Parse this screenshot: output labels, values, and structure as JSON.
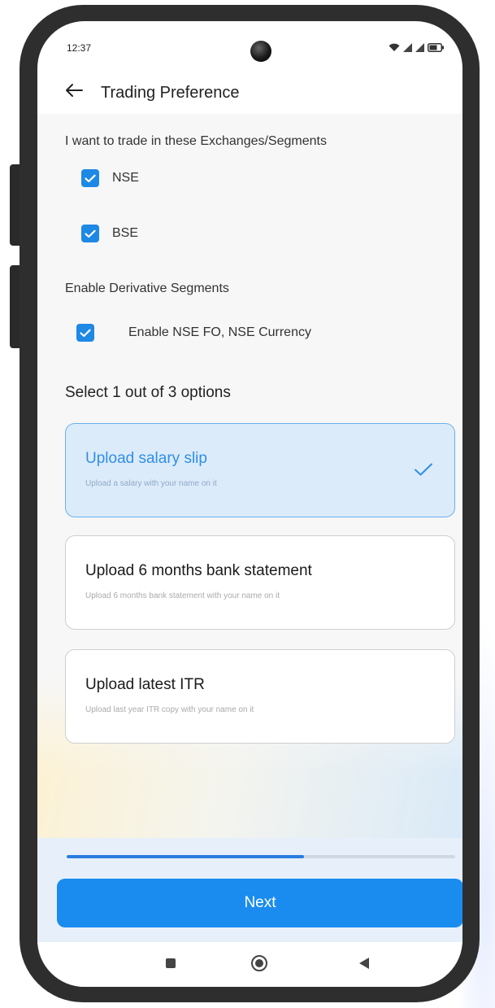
{
  "status_bar": {
    "time": "12:37",
    "icons": [
      "wifi-icon",
      "signal-icon",
      "signal-icon",
      "battery-icon"
    ]
  },
  "app_bar": {
    "back_icon": "arrow-left-icon",
    "title": "Trading Preference"
  },
  "exchanges": {
    "label": "I want to trade in these Exchanges/Segments",
    "items": [
      {
        "label": "NSE",
        "checked": true
      },
      {
        "label": "BSE",
        "checked": true
      }
    ]
  },
  "derivatives": {
    "label": "Enable Derivative Segments",
    "items": [
      {
        "label": "Enable NSE FO, NSE Currency",
        "checked": true
      }
    ]
  },
  "options": {
    "title": "Select 1 out of 3 options",
    "selected_index": 0,
    "items": [
      {
        "title": "Upload salary slip",
        "subtitle": "Upload a salary with your name on it"
      },
      {
        "title": "Upload 6 months bank statement",
        "subtitle": "Upload 6 months bank statement with your name on it"
      },
      {
        "title": "Upload latest ITR",
        "subtitle": "Upload last year ITR copy with your name on it"
      }
    ]
  },
  "progress": {
    "value_percent": 61
  },
  "next_button": {
    "label": "Next"
  },
  "nav_bar": {
    "icons": [
      "square-icon",
      "circle-home-icon",
      "triangle-back-icon"
    ]
  },
  "colors": {
    "accent": "#1a8cf0",
    "checkbox": "#1e88e5",
    "selected_card_bg": "#dcebfa",
    "selected_text": "#2f8fe6"
  }
}
